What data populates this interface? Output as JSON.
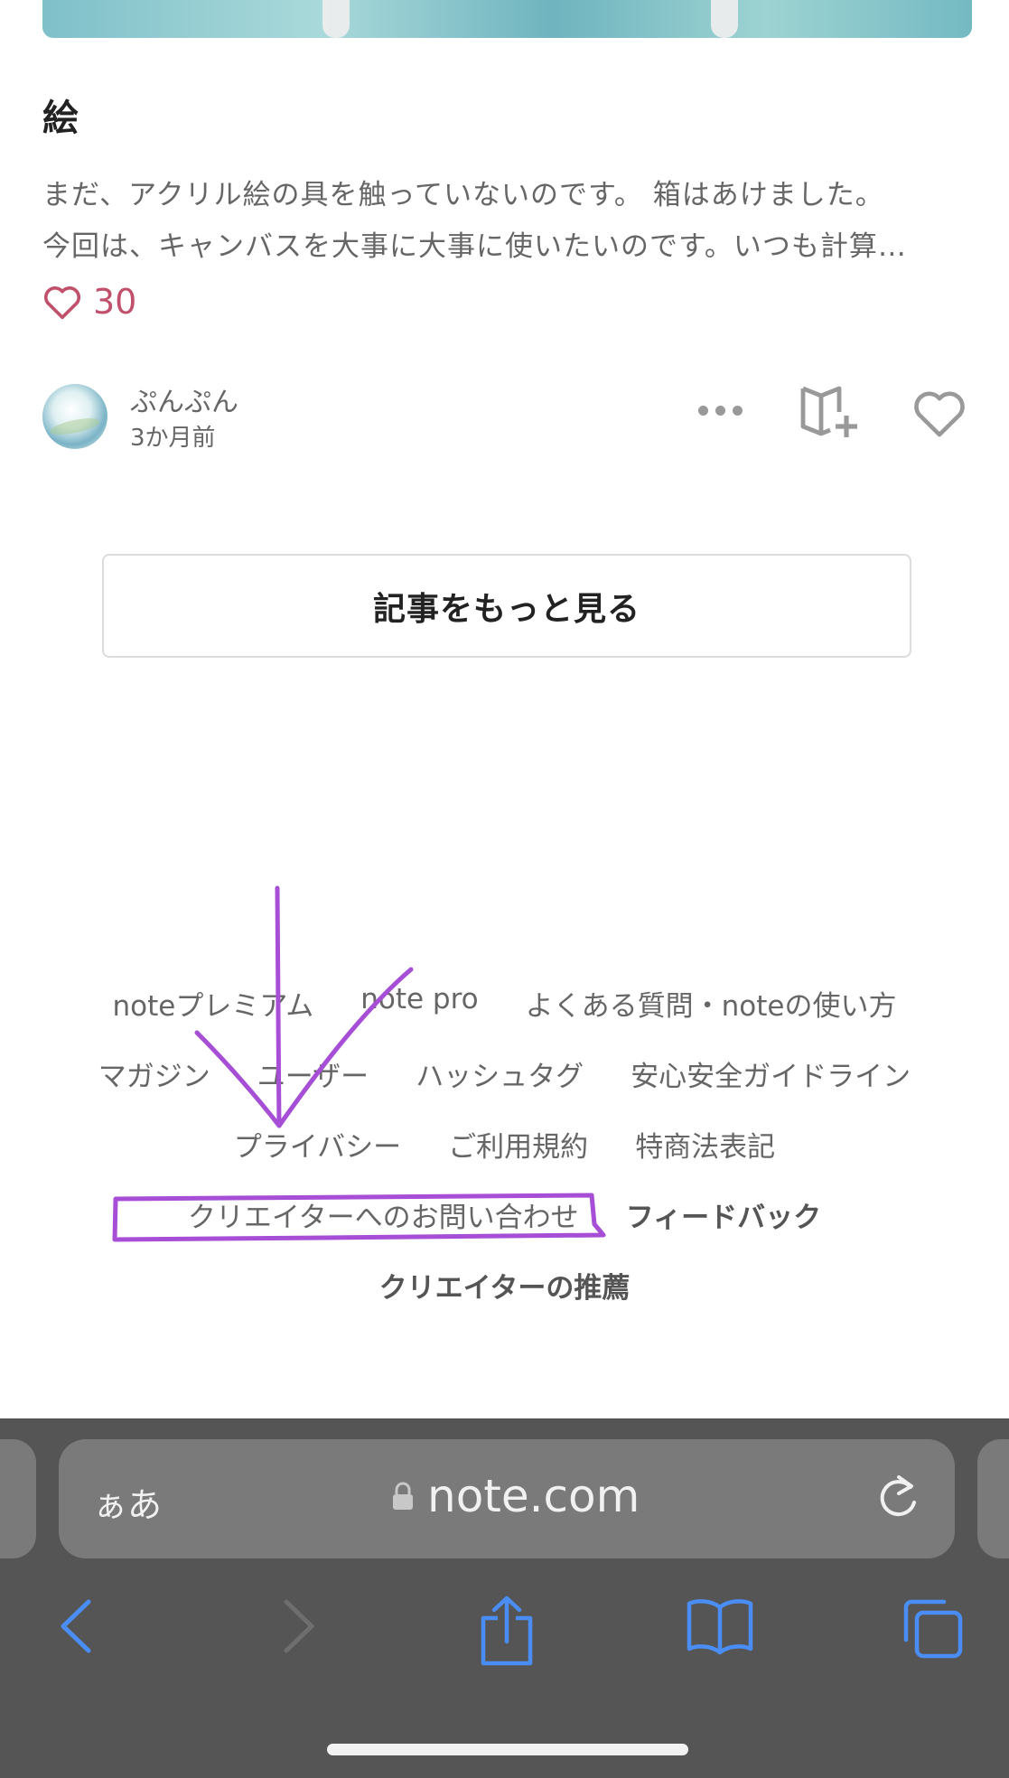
{
  "article": {
    "title": "絵",
    "excerpt_line1": "まだ、アクリル絵の具を触っていないのです。 箱はあけました。",
    "excerpt_line2": "今回は、キャンバスを大事に大事に使いたいのです。いつも計算…",
    "like_count": "30",
    "author": "ぷんぷん",
    "posted": "3か月前"
  },
  "more_button_label": "記事をもっと見る",
  "footer": {
    "row1": [
      "noteプレミアム",
      "note pro",
      "よくある質問・noteの使い方"
    ],
    "row2": [
      "マガジン",
      "ユーザー",
      "ハッシュタグ",
      "安心安全ガイドライン"
    ],
    "row3": [
      "プライバシー",
      "ご利用規約",
      "特商法表記"
    ],
    "row4": [
      "クリエイターへのお問い合わせ",
      "フィードバック"
    ],
    "row5": [
      "クリエイターの推薦"
    ]
  },
  "browser": {
    "text_size_label": "ぁあ",
    "url": "note.com"
  },
  "colors": {
    "like_accent": "#c0506b",
    "annotation": "#a64fd6",
    "browser_bar": "#555555",
    "toolbar_icon": "#4a8ef5"
  },
  "icons": [
    "heart-icon",
    "more-icon",
    "magazine-add-icon",
    "lock-icon",
    "reload-icon",
    "back-icon",
    "forward-icon",
    "share-icon",
    "bookmarks-icon",
    "tabs-icon"
  ]
}
